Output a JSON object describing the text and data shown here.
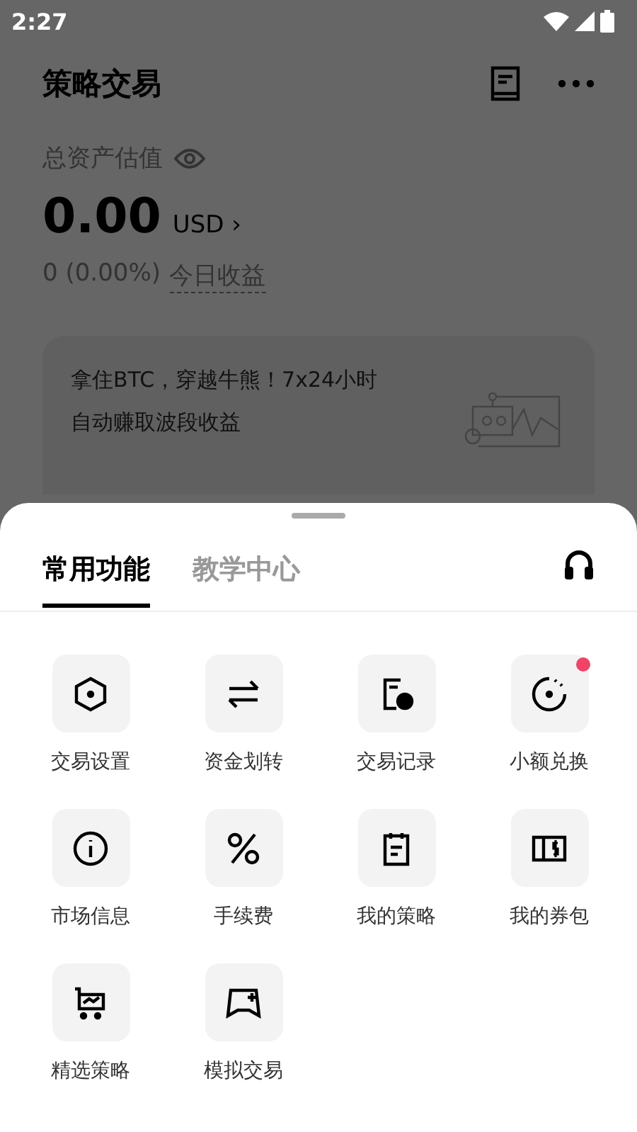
{
  "status_bar": {
    "time": "2:27"
  },
  "header": {
    "title": "策略交易"
  },
  "assets": {
    "label": "总资产估值",
    "value": "0.00",
    "currency": "USD",
    "arrow": "›",
    "change": "0 (0.00%)",
    "change_label": "今日收益"
  },
  "banner": {
    "lines": [
      "拿住BTC，穿越牛熊！7x24小时",
      "自动赚取波段收益"
    ]
  },
  "tabs": [
    {
      "label": "常用功能",
      "selected": true
    },
    {
      "label": "教学中心",
      "selected": false
    }
  ],
  "features": [
    {
      "label": "交易设置",
      "kind": "hexagon",
      "badge": false
    },
    {
      "label": "资金划转",
      "kind": "transfer",
      "badge": false
    },
    {
      "label": "交易记录",
      "kind": "record",
      "badge": false
    },
    {
      "label": "小额兑换",
      "kind": "convert",
      "badge": true
    },
    {
      "label": "市场信息",
      "kind": "info",
      "badge": false
    },
    {
      "label": "手续费",
      "kind": "percent",
      "badge": false
    },
    {
      "label": "我的策略",
      "kind": "clipboard",
      "badge": false
    },
    {
      "label": "我的券包",
      "kind": "coupon",
      "badge": false
    },
    {
      "label": "精选策略",
      "kind": "cart",
      "badge": false
    },
    {
      "label": "模拟交易",
      "kind": "simulate",
      "badge": false
    }
  ]
}
